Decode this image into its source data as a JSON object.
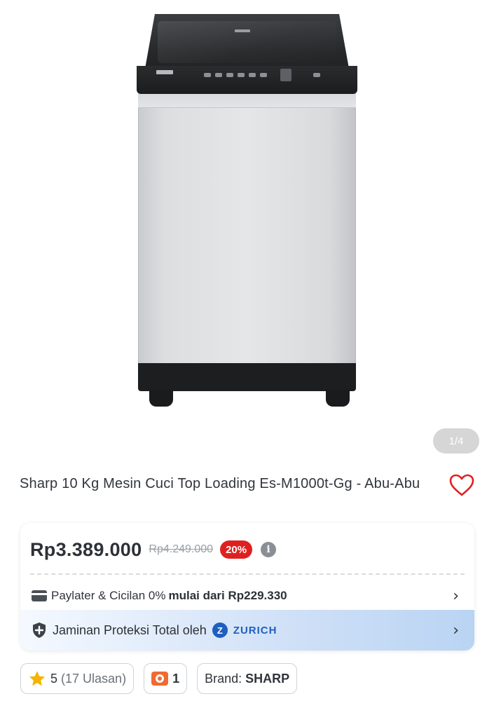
{
  "gallery": {
    "counter": "1/4"
  },
  "product": {
    "title": "Sharp 10 Kg Mesin Cuci Top Loading Es-M1000t-Gg - Abu-Abu",
    "price": "Rp3.389.000",
    "original_price": "Rp4.249.000",
    "discount": "20%",
    "info_icon": "i"
  },
  "paylater": {
    "label": "Paylater & Cicilan 0%",
    "highlight": "mulai dari Rp229.330"
  },
  "protection": {
    "label": "Jaminan Proteksi Total oleh",
    "provider": "ZURICH",
    "provider_logo_letter": "Z"
  },
  "chips": {
    "rating_value": "5",
    "rating_count": "(17 Ulasan)",
    "media_count": "1",
    "brand_label": "Brand:",
    "brand_value": "SHARP"
  },
  "colors": {
    "discount_badge": "#e02020",
    "favorite_heart": "#e02020",
    "zurich_blue": "#1f5fbf",
    "star": "#f5b400",
    "camera": "#f06a32"
  },
  "icons": [
    "heart-outline-icon",
    "info-icon",
    "card-icon",
    "chevron-right-icon",
    "shield-plus-icon",
    "zurich-logo-icon",
    "star-icon",
    "camera-icon"
  ]
}
